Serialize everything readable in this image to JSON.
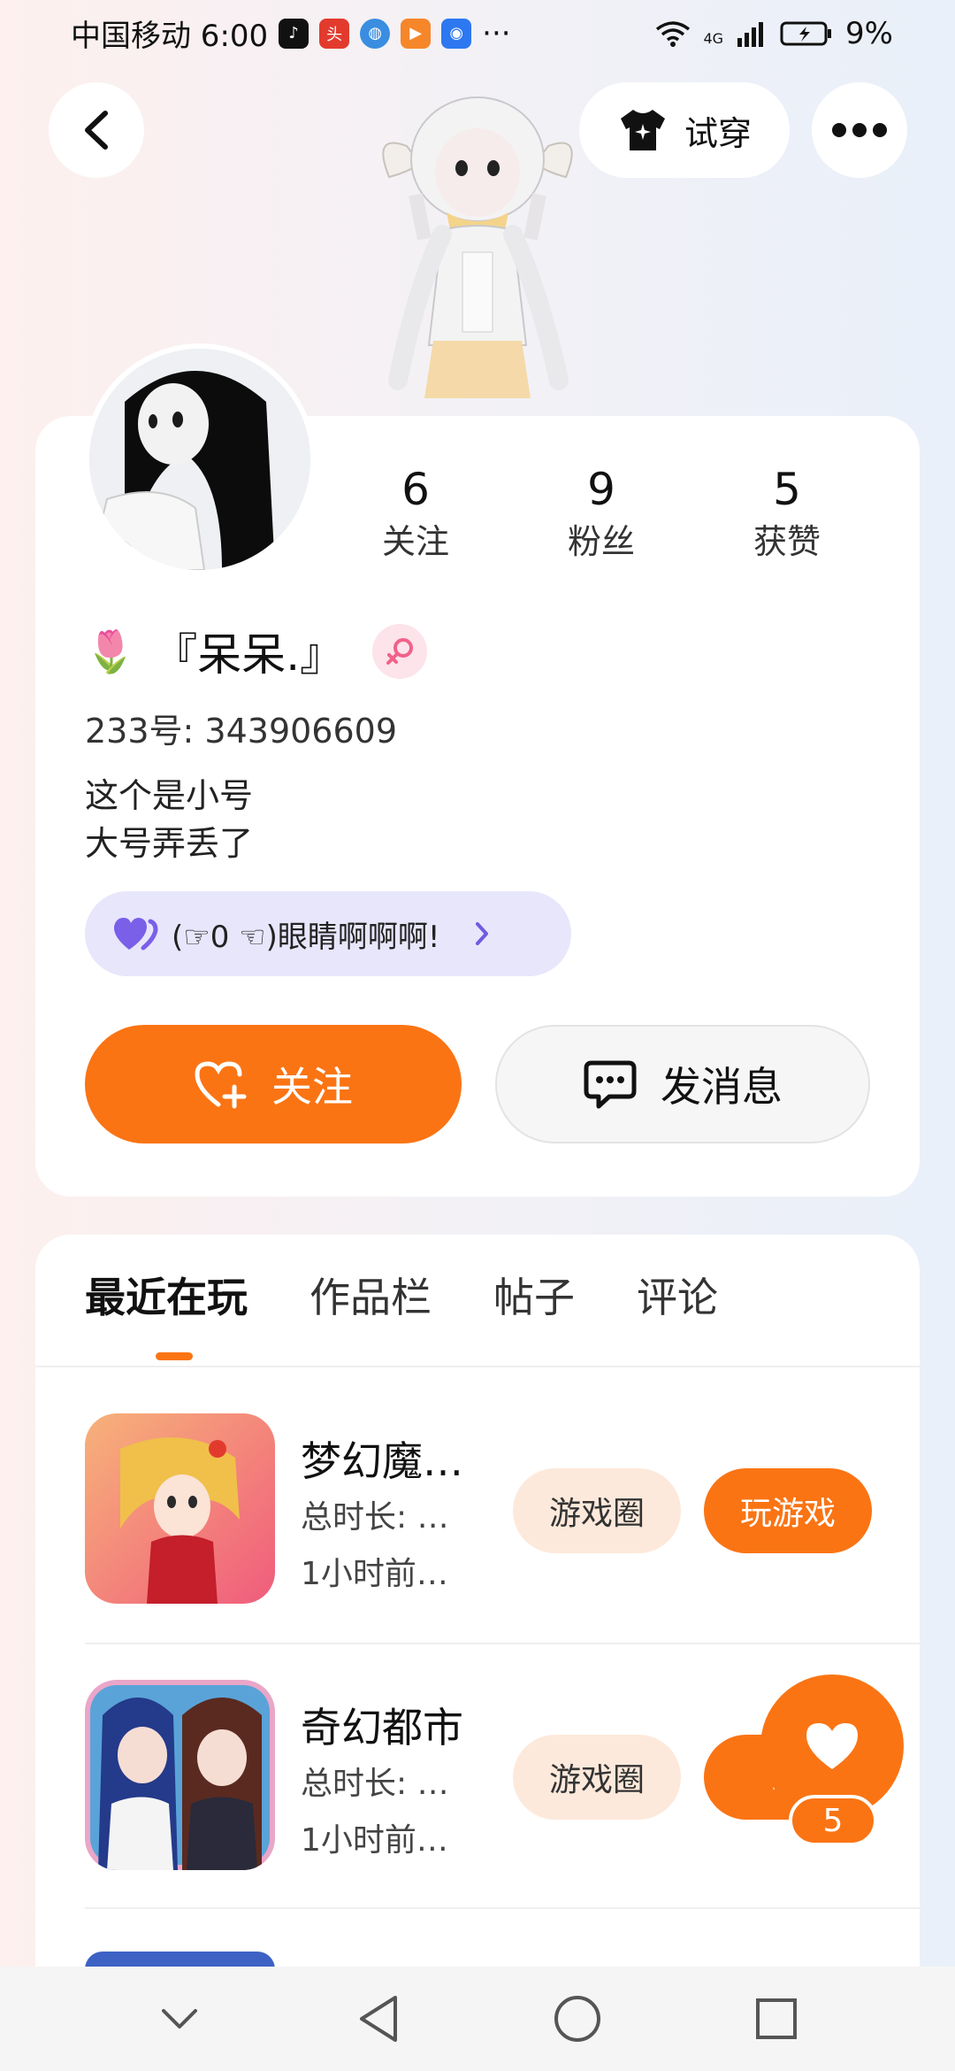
{
  "status_bar": {
    "carrier_time": "中国移动 6:00",
    "more_dots": "···",
    "network": "4G",
    "battery": "9%"
  },
  "header": {
    "tryon_label": "试穿"
  },
  "profile": {
    "stats": [
      {
        "num": "6",
        "label": "关注"
      },
      {
        "num": "9",
        "label": "粉丝"
      },
      {
        "num": "5",
        "label": "获赞"
      }
    ],
    "name_emoji": "🌷",
    "name": "『呆呆.』",
    "uid": "233号: 343906609",
    "bio_line1": "这个是小号",
    "bio_line2": "大号弄丢了",
    "signature": "(☞0 ☜)眼睛啊啊啊!",
    "follow_label": "关注",
    "message_label": "发消息"
  },
  "tabs": [
    {
      "label": "最近在玩"
    },
    {
      "label": "作品栏"
    },
    {
      "label": "帖子"
    },
    {
      "label": "评论"
    }
  ],
  "games": [
    {
      "title": "梦幻魔…",
      "duration": "总时长: …",
      "last_played": "1小时前…",
      "circle_label": "游戏圈",
      "play_label": "玩游戏"
    },
    {
      "title": "奇幻都市",
      "duration": "总时长: …",
      "last_played": "1小时前…",
      "circle_label": "游戏圈",
      "play_label": "玩"
    }
  ],
  "like_fab": {
    "count": "5"
  },
  "colors": {
    "accent": "#fa7414",
    "accent_soft": "#fde9db",
    "pill_bg": "#e8e6fb"
  }
}
